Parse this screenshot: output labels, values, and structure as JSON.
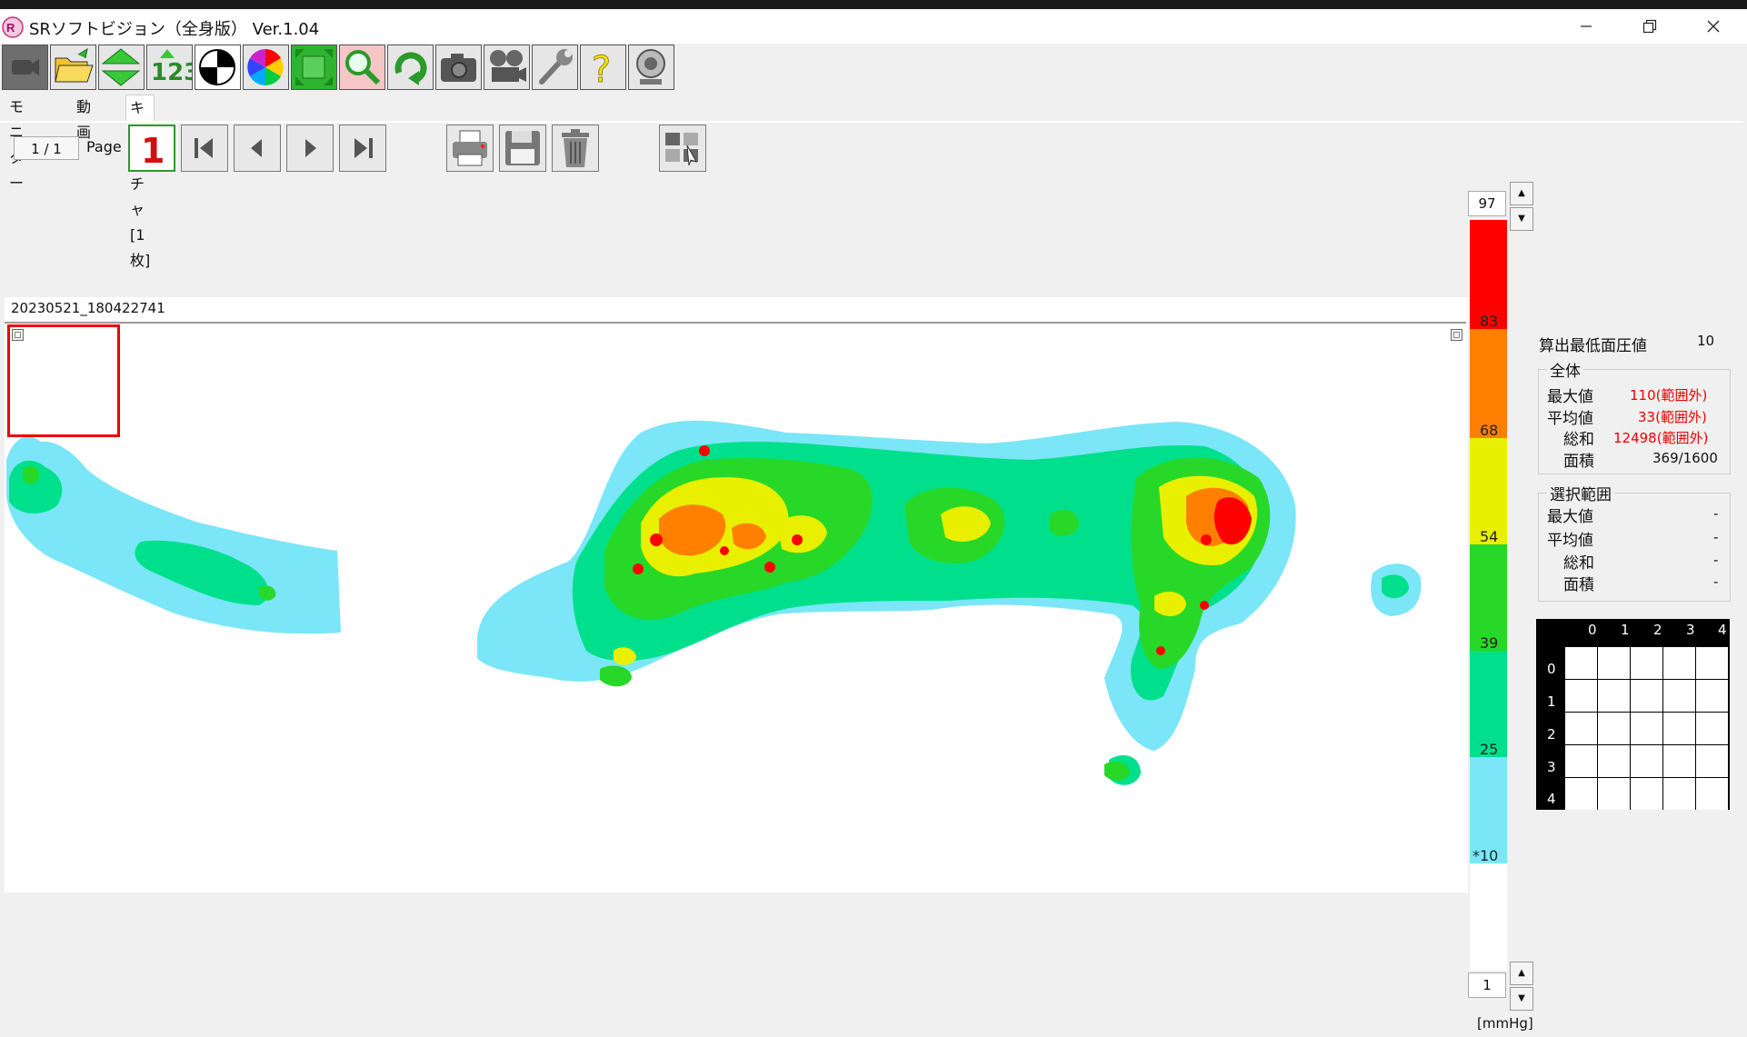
{
  "window": {
    "title": "SRソフトビジョン（全身版） Ver.1.04",
    "minimize": "—",
    "restore": "❐",
    "close": "✕"
  },
  "toolbar": {
    "buttons": [
      {
        "name": "camera-off-icon"
      },
      {
        "name": "open-folder-icon"
      },
      {
        "name": "up-down-arrows-icon"
      },
      {
        "name": "numbers-123-icon",
        "label": "123"
      },
      {
        "name": "contrast-icon"
      },
      {
        "name": "color-wheel-icon"
      },
      {
        "name": "fit-frame-icon"
      },
      {
        "name": "magnifier-icon"
      },
      {
        "name": "rotate-icon"
      },
      {
        "name": "camera-icon"
      },
      {
        "name": "film-projector-icon"
      },
      {
        "name": "wrench-icon"
      },
      {
        "name": "help-icon",
        "label": "?"
      },
      {
        "name": "webcam-icon"
      }
    ]
  },
  "tabs": [
    {
      "label": "モニター",
      "active": false
    },
    {
      "label": "動画",
      "active": false
    },
    {
      "label": "キャプチャ [1枚]",
      "active": true
    }
  ],
  "capture": {
    "page_value": "1 / 1",
    "page_label": "Page",
    "first_page_label": "1",
    "file_label": "20230521_180422741"
  },
  "scale": {
    "max_value": "97",
    "min_value": "1",
    "unit": "[mmHg]",
    "labels": [
      "83",
      "68",
      "54",
      "39",
      "25",
      "*10"
    ],
    "colors": [
      "#ff0000",
      "#ff8000",
      "#e8f000",
      "#28d828",
      "#00e08c",
      "#7ae6f8",
      "#ffffff"
    ]
  },
  "info": {
    "min_pressure_label": "算出最低面圧値",
    "min_pressure_value": "10",
    "overall": {
      "title": "全体",
      "max_label": "最大値",
      "max_value": "110(範囲外)",
      "avg_label": "平均値",
      "avg_value": "33(範囲外)",
      "sum_label": "総和",
      "sum_value": "12498(範囲外)",
      "area_label": "面積",
      "area_value": "369/1600"
    },
    "selection": {
      "title": "選択範囲",
      "max_label": "最大値",
      "max_value": "-",
      "avg_label": "平均値",
      "avg_value": "-",
      "sum_label": "総和",
      "sum_value": "-",
      "area_label": "面積",
      "area_value": "-"
    }
  },
  "grid": {
    "col_headers": [
      "0",
      "1",
      "2",
      "3",
      "4"
    ],
    "row_headers": [
      "0",
      "1",
      "2",
      "3",
      "4"
    ]
  }
}
